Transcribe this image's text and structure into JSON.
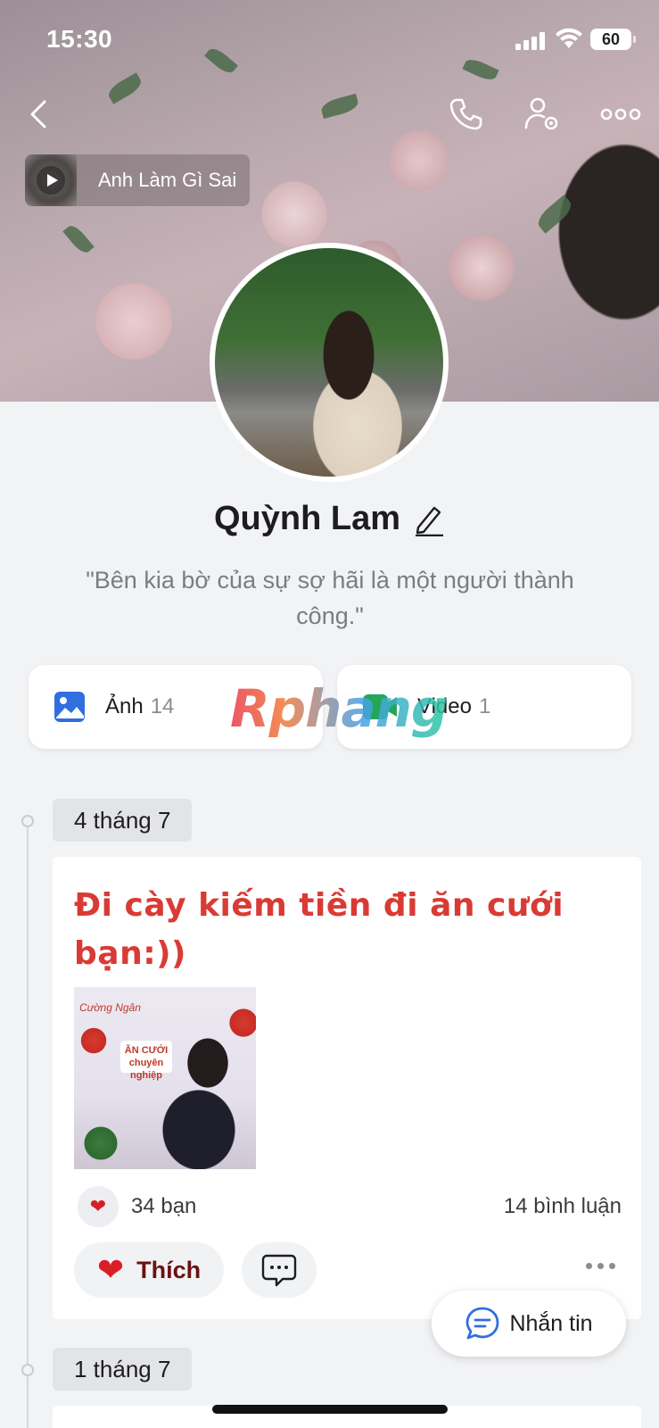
{
  "status_bar": {
    "time": "15:30",
    "battery": "60"
  },
  "header": {
    "music_title": "Anh Làm Gì Sai"
  },
  "profile": {
    "name": "Quỳnh Lam",
    "bio": "\"Bên kia bờ của sự sợ hãi là một người thành công.\""
  },
  "media": {
    "photos_label": "Ảnh",
    "photos_count": "14",
    "videos_label": "Video",
    "videos_count": "1"
  },
  "watermark": "Rphang",
  "timeline": {
    "groups": [
      {
        "date": "4 tháng 7"
      },
      {
        "date": "1 tháng 7"
      }
    ]
  },
  "post": {
    "text": "Đi cày kiếm tiền đi ăn cưới bạn:))",
    "photo_brand": "Cường Ngân",
    "photo_sign": "ĂN CƯỚI chuyên nghiệp",
    "reactions": "34 bạn",
    "comments": "14 bình luận",
    "like_label": "Thích"
  },
  "fab": {
    "label": "Nhắn tin"
  },
  "colors": {
    "accent_blue": "#2f6fe0",
    "post_text_red": "#d93b34",
    "heart_red": "#d81f26",
    "page_bg": "#f2f3f5"
  },
  "icons": [
    "back-icon",
    "phone-icon",
    "user-settings-icon",
    "more-icon",
    "play-icon",
    "edit-icon",
    "image-icon",
    "video-icon",
    "heart-icon",
    "comment-icon",
    "message-icon"
  ]
}
